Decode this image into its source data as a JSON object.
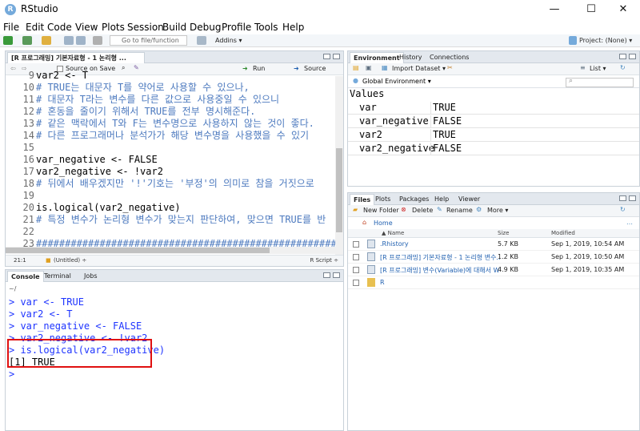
{
  "app": {
    "title": "RStudio",
    "logo_letter": "R"
  },
  "window_controls": {
    "minimize": "—",
    "maximize": "☐",
    "close": "✕"
  },
  "menu": [
    "File",
    "Edit",
    "Code",
    "View",
    "Plots",
    "Session",
    "Build",
    "Debug",
    "Profile",
    "Tools",
    "Help"
  ],
  "toolbar": {
    "goto_placeholder": "Go to file/function",
    "addins": "Addins ▾",
    "project": "Project: (None) ▾"
  },
  "editor": {
    "tab_label": "[R 프로그래밍] 기본자료형 - 1 논리형 ...",
    "source_on_save": "Source on Save",
    "run": "Run",
    "source": "Source",
    "lines": [
      {
        "n": "9",
        "text": "var2 <- T",
        "kind": "code"
      },
      {
        "n": "10",
        "text": "# TRUE는 대문자 T를 약어로 사용할 수 있으나,",
        "kind": "comment"
      },
      {
        "n": "11",
        "text": "# 대문자 T라는 변수를 다른 값으로 사용중일 수 있으니",
        "kind": "comment"
      },
      {
        "n": "12",
        "text": "# 혼동을 줄이기 위해서 TRUE를 전부 명시해준다.",
        "kind": "comment"
      },
      {
        "n": "13",
        "text": "# 같은 맥락에서 T와 F는 변수명으로 사용하지 않는 것이 좋다.",
        "kind": "comment"
      },
      {
        "n": "14",
        "text": "# 다른 프로그래머나 분석가가 해당 변수명을 사용했을 수 있기",
        "kind": "comment"
      },
      {
        "n": "15",
        "text": "",
        "kind": "code"
      },
      {
        "n": "16",
        "text": "var_negative <- FALSE",
        "kind": "code"
      },
      {
        "n": "17",
        "text": "var2_negative <- !var2",
        "kind": "code"
      },
      {
        "n": "18",
        "text": "# 뒤에서 배우겠지만 '!'기호는 '부정'의 의미로 참을 거짓으로",
        "kind": "comment"
      },
      {
        "n": "19",
        "text": "",
        "kind": "code"
      },
      {
        "n": "20",
        "text": "is.logical(var2_negative)",
        "kind": "code"
      },
      {
        "n": "21",
        "text": "# 특정 변수가 논리형 변수가 맞는지 판단하여, 맞으면 TRUE를 반",
        "kind": "comment"
      },
      {
        "n": "22",
        "text": "",
        "kind": "code"
      },
      {
        "n": "23",
        "text": "##########################################################",
        "kind": "comment"
      }
    ],
    "status_pos": "21:1",
    "status_scope": "(Untitled) ÷",
    "status_type": "R Script ÷"
  },
  "console": {
    "tabs": [
      "Console",
      "Terminal",
      "Jobs"
    ],
    "path": "~/",
    "lines": [
      {
        "text": "> var <- TRUE",
        "kind": "prompt"
      },
      {
        "text": "> var2 <- T",
        "kind": "prompt"
      },
      {
        "text": "> var_negative <- FALSE",
        "kind": "prompt"
      },
      {
        "text": "> var2_negative <- !var2",
        "kind": "prompt"
      },
      {
        "text": "> is.logical(var2_negative)",
        "kind": "prompt"
      },
      {
        "text": "[1] TRUE",
        "kind": "output"
      },
      {
        "text": ">",
        "kind": "prompt"
      }
    ]
  },
  "environment": {
    "tabs": [
      "Environment",
      "History",
      "Connections"
    ],
    "import_dataset": "Import Dataset ▾",
    "list_view": "List ▾",
    "scope": "Global Environment ▾",
    "section": "Values",
    "rows": [
      {
        "name": "var",
        "value": "TRUE"
      },
      {
        "name": "var_negative",
        "value": "FALSE"
      },
      {
        "name": "var2",
        "value": "TRUE"
      },
      {
        "name": "var2_negative",
        "value": "FALSE"
      }
    ]
  },
  "files": {
    "tabs": [
      "Files",
      "Plots",
      "Packages",
      "Help",
      "Viewer"
    ],
    "new_folder": "New Folder",
    "delete": "Delete",
    "rename": "Rename",
    "more": "More ▾",
    "breadcrumb": "Home",
    "columns": [
      "▲ Name",
      "Size",
      "Modified"
    ],
    "rows": [
      {
        "name": ".Rhistory",
        "size": "5.7 KB",
        "modified": "Sep 1, 2019, 10:54 AM",
        "type": "file"
      },
      {
        "name": "[R 프로그래밍] 기본자료형 - 1 논리형 변수...",
        "size": "1.2 KB",
        "modified": "Sep 1, 2019, 10:50 AM",
        "type": "file"
      },
      {
        "name": "[R 프로그래밍] 변수(Variable)에 대해서 Wit...",
        "size": "4.9 KB",
        "modified": "Sep 1, 2019, 10:35 AM",
        "type": "file"
      },
      {
        "name": "R",
        "size": "",
        "modified": "",
        "type": "folder"
      }
    ]
  },
  "colors": {
    "accent": "#75aadb",
    "prompt": "#1e34ff",
    "comment": "#4d7abf",
    "highlight": "#e01010"
  }
}
